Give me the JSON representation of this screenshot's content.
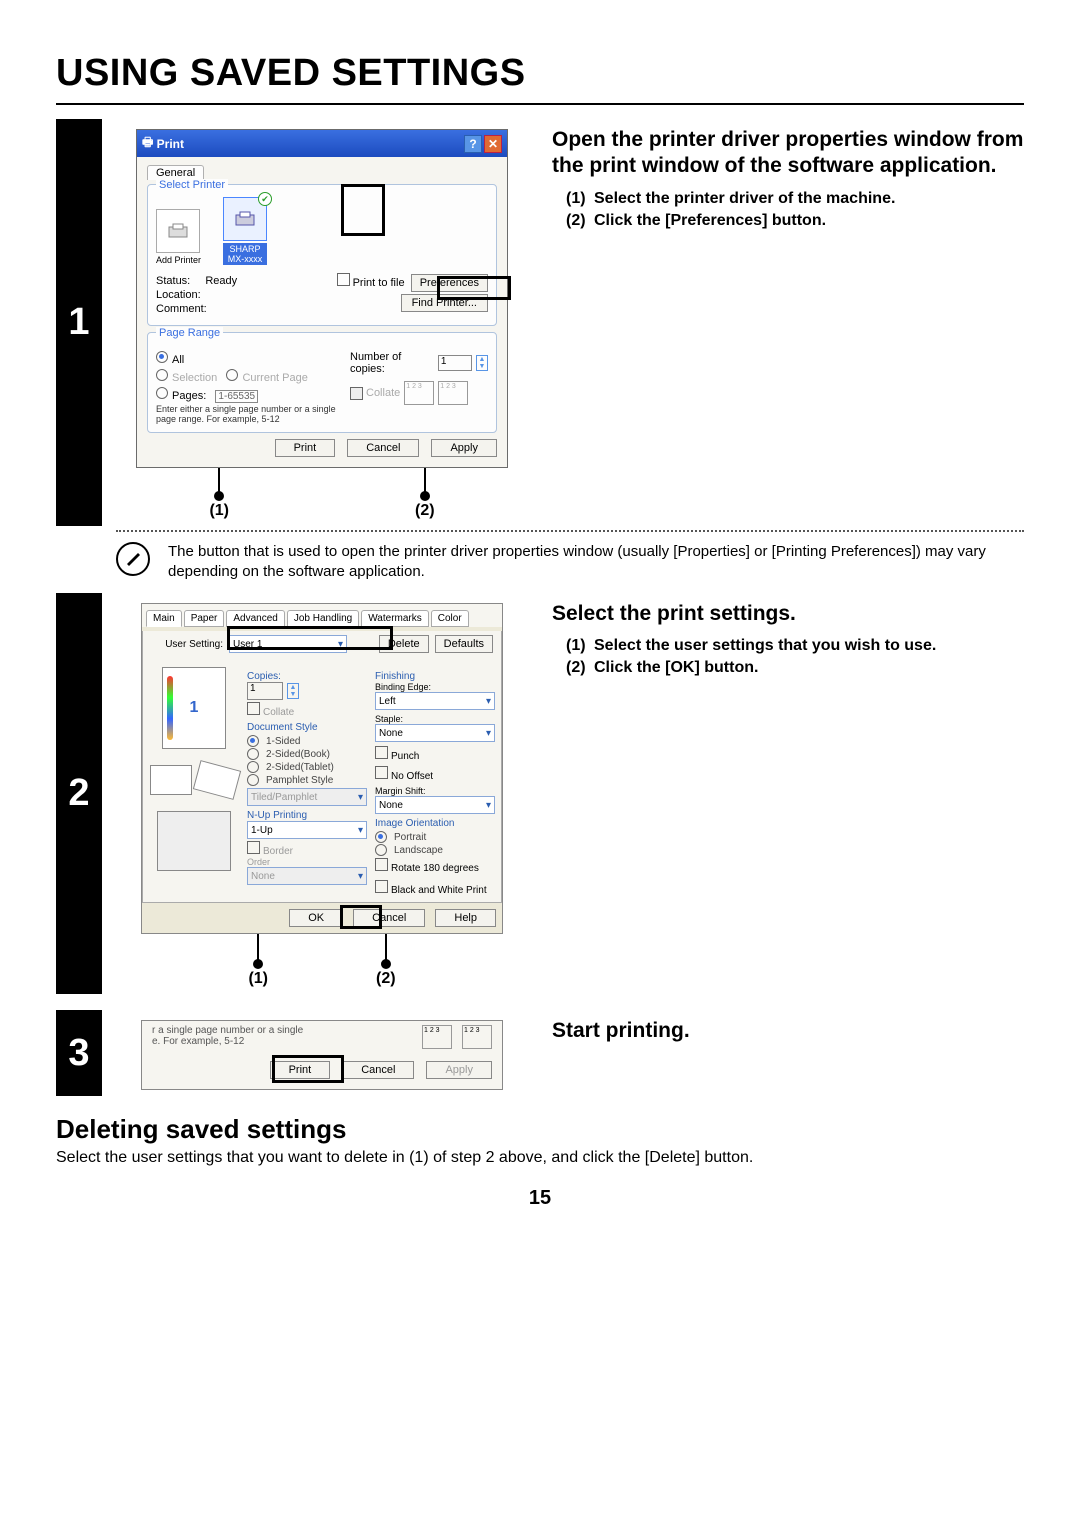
{
  "page": {
    "title": "USING SAVED SETTINGS",
    "number": "15",
    "subhead": "Deleting saved settings",
    "subtext": "Select the user settings that you want to delete in (1) of step 2 above, and click the [Delete] button."
  },
  "step1": {
    "num": "1",
    "lead": "Open the printer driver properties window from the print window of the software application.",
    "items": [
      "Select the printer driver of the machine.",
      "Click the [Preferences] button."
    ],
    "callout1": "(1)",
    "callout2": "(2)",
    "dlg": {
      "title": "Print",
      "tab": "General",
      "selectPrinter": "Select Printer",
      "addPrinter": "Add Printer",
      "printerName": "SHARP\nMX-xxxx",
      "status_l": "Status:",
      "status_v": "Ready",
      "location_l": "Location:",
      "comment_l": "Comment:",
      "printToFile": "Print to file",
      "preferences": "Preferences",
      "findPrinter": "Find Printer...",
      "pageRange": "Page Range",
      "all": "All",
      "selection": "Selection",
      "currentPage": "Current Page",
      "pages": "Pages:",
      "pagesVal": "1-65535",
      "pageHint": "Enter either a single page number or a single page range. For example, 5-12",
      "numCopies": "Number of copies:",
      "copiesVal": "1",
      "collate": "Collate",
      "print": "Print",
      "cancel": "Cancel",
      "apply": "Apply"
    },
    "note": "The button that is used to open the printer driver properties window (usually [Properties] or [Printing Preferences]) may vary depending on the software application."
  },
  "step2": {
    "num": "2",
    "lead": "Select the print settings.",
    "items": [
      "Select the user settings that you wish to use.",
      "Click the [OK] button."
    ],
    "callout1": "(1)",
    "callout2": "(2)",
    "dlg": {
      "tabs": [
        "Main",
        "Paper",
        "Advanced",
        "Job Handling",
        "Watermarks",
        "Color"
      ],
      "userSetting_l": "User Setting:",
      "userSetting_v": "User 1",
      "delete": "Delete",
      "defaults": "Defaults",
      "copies_l": "Copies:",
      "copies_v": "1",
      "collate": "Collate",
      "docStyle": "Document Style",
      "ds": [
        "1-Sided",
        "2-Sided(Book)",
        "2-Sided(Tablet)",
        "Pamphlet Style"
      ],
      "tiled": "Tiled/Pamphlet",
      "nup_l": "N-Up Printing",
      "nup_v": "1-Up",
      "border": "Border",
      "order": "Order",
      "none": "None",
      "finishing": "Finishing",
      "bind_l": "Binding Edge:",
      "bind_v": "Left",
      "staple_l": "Staple:",
      "staple_v": "None",
      "punch": "Punch",
      "noOffset": "No Offset",
      "mshift_l": "Margin Shift:",
      "mshift_v": "None",
      "imageOri": "Image Orientation",
      "portrait": "Portrait",
      "landscape": "Landscape",
      "rotate": "Rotate 180 degrees",
      "bw": "Black and White Print",
      "ok": "OK",
      "cancel": "Cancel",
      "help": "Help",
      "prevNum": "1"
    }
  },
  "step3": {
    "num": "3",
    "lead": "Start printing.",
    "dlg": {
      "hint1": "r a single page number or a single",
      "hint2": "e. For example, 5-12",
      "print": "Print",
      "cancel": "Cancel",
      "apply": "Apply"
    }
  }
}
